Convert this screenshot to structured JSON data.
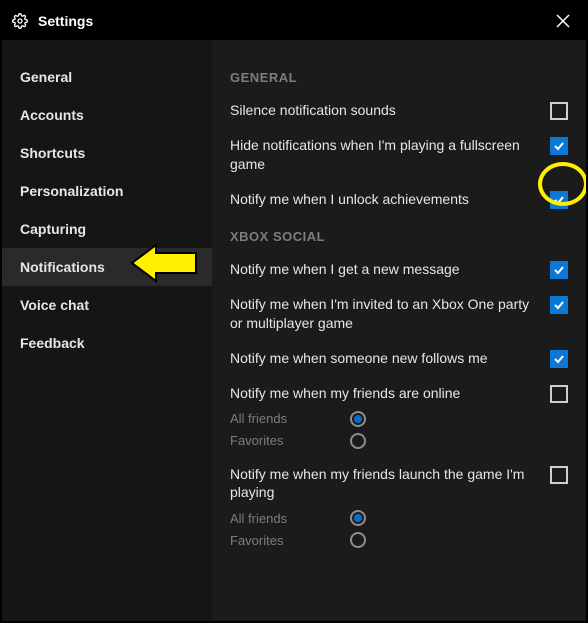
{
  "window": {
    "title": "Settings"
  },
  "sidebar": {
    "items": [
      {
        "label": "General"
      },
      {
        "label": "Accounts"
      },
      {
        "label": "Shortcuts"
      },
      {
        "label": "Personalization"
      },
      {
        "label": "Capturing"
      },
      {
        "label": "Notifications"
      },
      {
        "label": "Voice chat"
      },
      {
        "label": "Feedback"
      }
    ],
    "active_index": 5
  },
  "sections": {
    "general": {
      "heading": "GENERAL",
      "items": [
        {
          "label": "Silence notification sounds",
          "checked": false
        },
        {
          "label": "Hide notifications when I'm playing a fullscreen game",
          "checked": true
        },
        {
          "label": "Notify me when I unlock achievements",
          "checked": true
        }
      ]
    },
    "xbox_social": {
      "heading": "XBOX SOCIAL",
      "items": [
        {
          "label": "Notify me when I get a new message",
          "checked": true
        },
        {
          "label": "Notify me when I'm invited to an Xbox One party or multiplayer game",
          "checked": true
        },
        {
          "label": "Notify me when someone new follows me",
          "checked": true
        },
        {
          "label": "Notify me when my friends are online",
          "checked": false,
          "radios": [
            {
              "label": "All friends",
              "selected": true
            },
            {
              "label": "Favorites",
              "selected": false
            }
          ]
        },
        {
          "label": "Notify me when my friends launch the game I'm playing",
          "checked": false,
          "radios": [
            {
              "label": "All friends",
              "selected": true
            },
            {
              "label": "Favorites",
              "selected": false
            }
          ]
        }
      ]
    }
  },
  "annotation": {
    "circle_target": "checkbox-achievements",
    "arrow_target": "sidebar-item-notifications"
  }
}
